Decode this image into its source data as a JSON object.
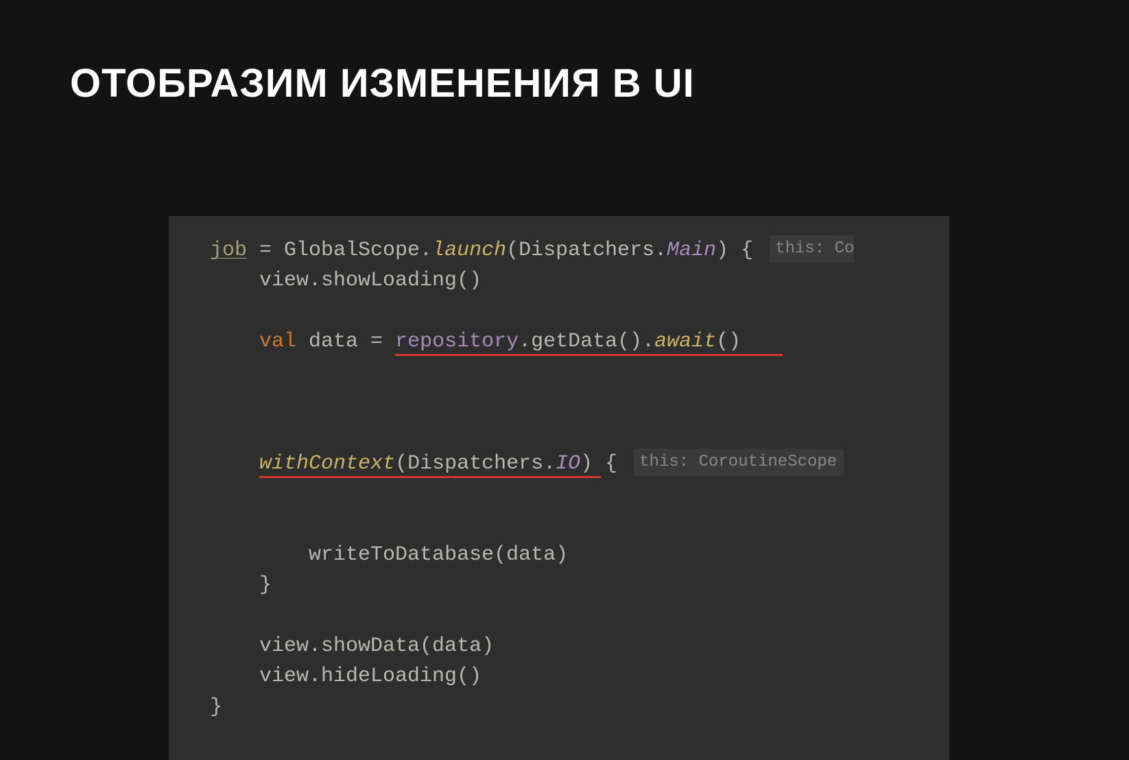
{
  "title": "ОТОБРАЗИМ ИЗМЕНЕНИЯ В UI",
  "code": {
    "line1": {
      "job": "job",
      "eq": " = GlobalScope.",
      "launch": "launch",
      "args": "(Dispatchers.",
      "main": "Main",
      "close": ") {",
      "hint": "this: Co"
    },
    "line2": {
      "indent": "    ",
      "text": "view.showLoading()"
    },
    "line3": {
      "indent": "    ",
      "val": "val",
      "data": " data = ",
      "repository": "repository",
      "getdata": ".getData().",
      "await": "await",
      "close": "()"
    },
    "line4": {
      "indent": "    ",
      "withContext": "withContext",
      "args": "(Dispatchers.",
      "io": "IO",
      "close": ") {",
      "hint": "this: CoroutineScope"
    },
    "line5": {
      "indent": "        ",
      "text": "writeToDatabase(data)"
    },
    "line6": {
      "indent": "    ",
      "text": "}"
    },
    "line7": {
      "indent": "    ",
      "text": "view.showData(data)"
    },
    "line8": {
      "indent": "    ",
      "text": "view.hideLoading()"
    },
    "line9": {
      "text": "}"
    }
  }
}
